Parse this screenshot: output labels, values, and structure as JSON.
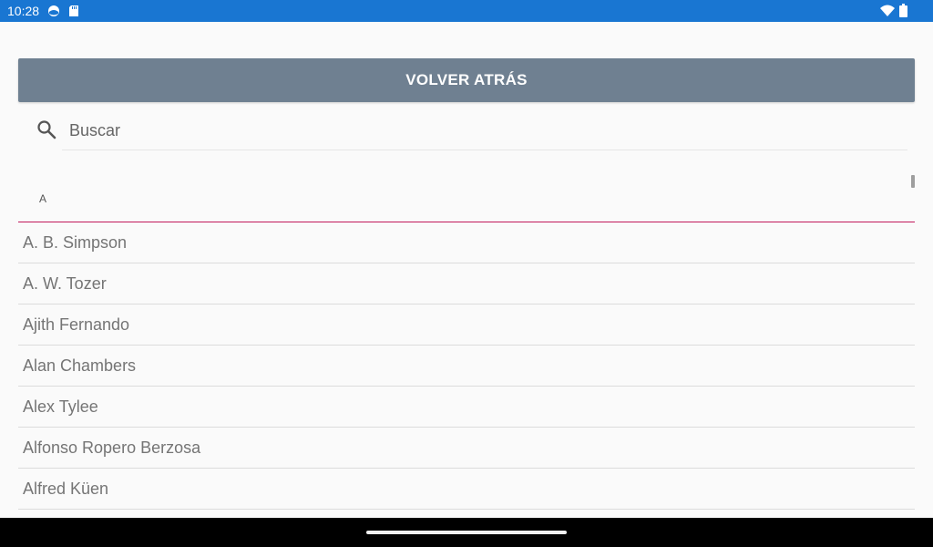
{
  "status_bar": {
    "time": "10:28",
    "left_icons": [
      "sync-icon",
      "sd-card-icon"
    ],
    "right_icons": [
      "wifi-icon",
      "battery-icon"
    ],
    "background_color": "#1976d2"
  },
  "toolbar": {
    "back_label": "VOLVER ATRÁS",
    "button_color": "#6f8091"
  },
  "search": {
    "placeholder": "Buscar",
    "value": ""
  },
  "contacts": {
    "section_letter": "A",
    "accent_color": "#c2185b",
    "items": [
      "A. B. Simpson",
      "A. W. Tozer",
      "Ajith Fernando",
      "Alan Chambers",
      "Alex Tylee",
      "Alfonso Ropero Berzosa",
      "Alfred Küen"
    ]
  }
}
